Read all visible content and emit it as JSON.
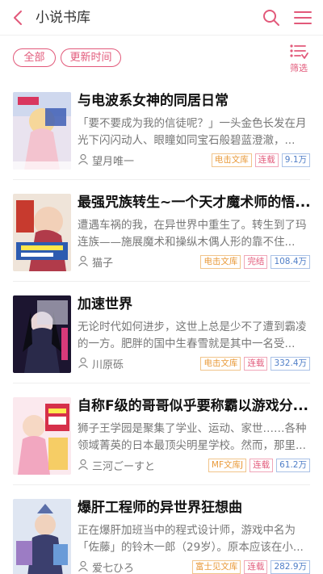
{
  "header": {
    "title": "小说书库",
    "back_icon": "chevron-left-icon",
    "search_icon": "search-icon",
    "menu_icon": "hamburger-menu-icon"
  },
  "filters": {
    "all_label": "全部",
    "sort_label": "更新时间",
    "filter_label": "筛选",
    "accent": "#e2597a"
  },
  "books": [
    {
      "title": "与电波系女神的同居日常",
      "desc": "「要不要成为我的信徒呢？」一头金色长发在月光下闪闪动人、眼瞳如同宝石般碧蓝澄澈，...",
      "author": "望月唯一",
      "publisher": "电击文库",
      "status": "连载",
      "count": "9.1万"
    },
    {
      "title": "最强咒族转生~一个天才魔术师的悟...",
      "desc": "遭遇车祸的我，在异世界中重生了。转生到了玛连族——施展魔术和操纵木偶人形的靠不住...",
      "author": "猫子",
      "publisher": "电击文库",
      "status": "完结",
      "count": "108.4万"
    },
    {
      "title": "加速世界",
      "desc": "无论时代如何进步，这世上总是少不了遭到霸凌的一方。肥胖的国中生春雪就是其中一名受...",
      "author": "川原砾",
      "publisher": "电击文库",
      "status": "连载",
      "count": "332.4万"
    },
    {
      "title": "自称F级的哥哥似乎要称霸以游戏分...",
      "desc": "狮子王学园是聚集了学业、运动、家世……各种领域菁英的日本最顶尖明星学校。然而，那里...",
      "author": "三河ごーすと",
      "publisher": "MF文库J",
      "status": "连载",
      "count": "61.2万"
    },
    {
      "title": "爆肝工程师的异世界狂想曲",
      "desc": "正在爆肝加班当中的程式设计师，游戏中名为「佐藤」的铃木一郎（29岁）。原本应该在小...",
      "author": "爱七ひろ",
      "publisher": "富士见文库",
      "status": "连载",
      "count": "282.9万"
    }
  ]
}
